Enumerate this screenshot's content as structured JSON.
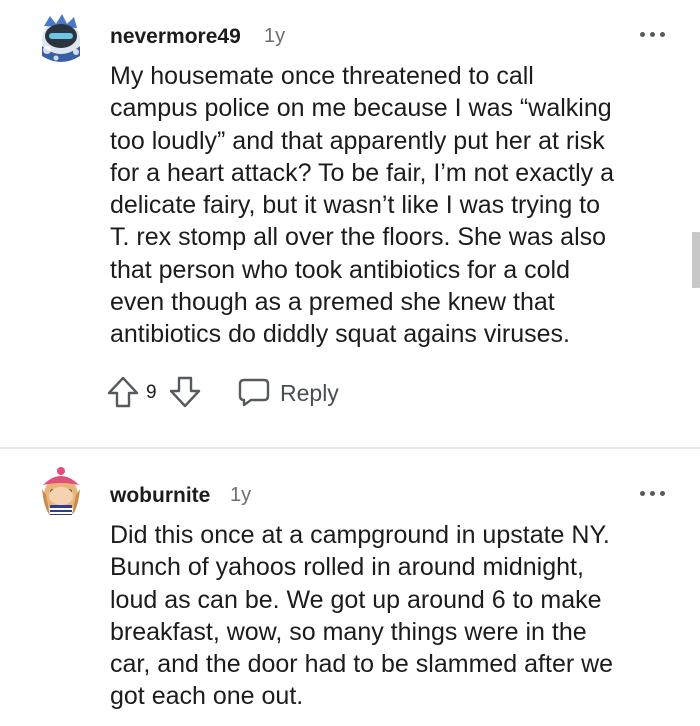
{
  "comments": [
    {
      "username": "nevermore49",
      "age": "1y",
      "avatar_icon": "snoo-avatar-blue-helmet-icon",
      "body_lines": [
        "My housemate once threatened to call",
        "campus police on me because I was “walking",
        "too loudly” and that apparently put her at risk",
        "for a heart attack? To be fair, I’m not exactly a",
        "delicate fairy, but it wasn’t like I was trying to",
        "T. rex stomp all over the floors. She was also",
        "that person who took antibiotics for a cold",
        "even though as a premed she knew that",
        "antibiotics do diddly squat agains viruses."
      ],
      "score": "9",
      "reply_label": "Reply"
    },
    {
      "username": "woburnite",
      "age": "1y",
      "avatar_icon": "snoo-avatar-pink-hat-icon",
      "body_lines": [
        "Did this once at a campground in upstate NY.",
        "Bunch of yahoos rolled in around midnight,",
        "loud as can be. We got up around 6 to make",
        "breakfast, wow, so many things were in the",
        "car, and the door had to be slammed after we",
        "got each one out."
      ]
    }
  ],
  "icons": {
    "more": "more-options-icon",
    "upvote": "upvote-arrow-icon",
    "downvote": "downvote-arrow-icon",
    "reply": "reply-bubble-icon"
  },
  "colors": {
    "text": "#1c1c1c",
    "meta": "#6b6f73",
    "icon": "#555a5e",
    "divider": "#e6e8ea"
  }
}
